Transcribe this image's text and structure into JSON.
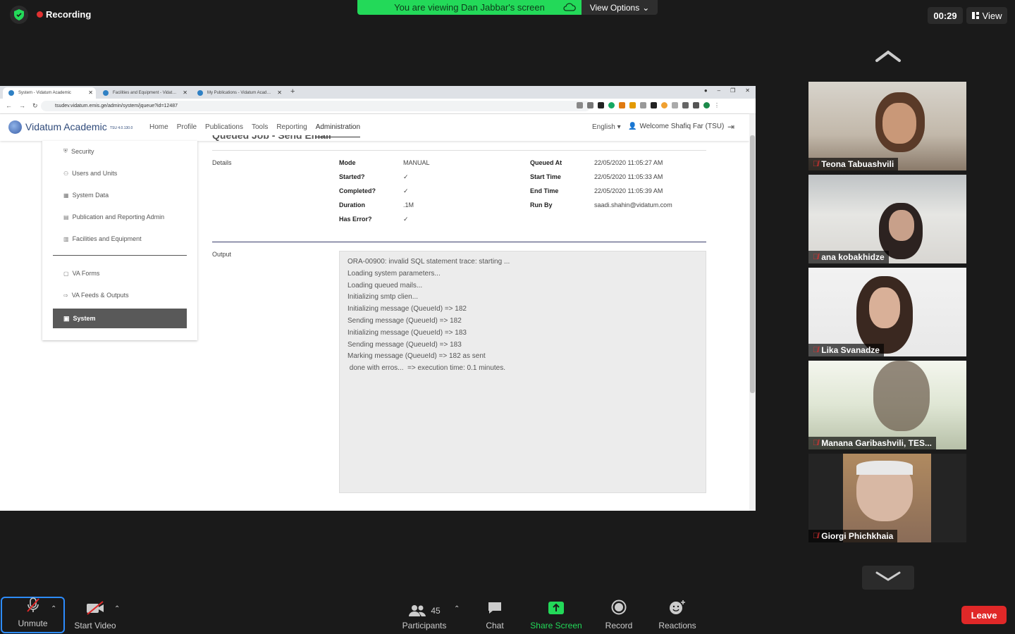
{
  "zoom": {
    "recording_label": "Recording",
    "viewing_banner": "You are viewing Dan Jabbar's screen",
    "view_options": "View Options",
    "timer": "00:29",
    "view_label": "View",
    "colors": {
      "banner": "#23d959",
      "leave": "#e02828",
      "focus": "#2d8cff",
      "share": "#23d959"
    }
  },
  "browser": {
    "tabs": [
      {
        "title": "System - Vidatum Academic",
        "active": true
      },
      {
        "title": "Facilities and Equipment - Vidat…",
        "active": false
      },
      {
        "title": "My Publications - Vidatum Acad…",
        "active": false
      }
    ],
    "url": "tsudev.vidatum.emis.ge/admin/system/jqueue?id=12487"
  },
  "app": {
    "brand": "Vidatum Academic",
    "version": "TSU 4.0.130.0",
    "menu": [
      "Home",
      "Profile",
      "Publications",
      "Tools",
      "Reporting",
      "Administration"
    ],
    "language": "English",
    "welcome": "Welcome Shafiq Far (TSU)"
  },
  "sidebar": {
    "items": [
      "Security",
      "Users and Units",
      "System Data",
      "Publication and Reporting Admin",
      "Facilities and Equipment",
      "VA Forms",
      "VA Feeds & Outputs"
    ],
    "active": "System"
  },
  "page": {
    "title": "Queued Job - Send Email",
    "details_label": "Details",
    "details_left": [
      {
        "label": "Mode",
        "value": "MANUAL"
      },
      {
        "label": "Started?",
        "value": "✓"
      },
      {
        "label": "Completed?",
        "value": "✓"
      },
      {
        "label": "Duration",
        "value": ".1M"
      },
      {
        "label": "Has Error?",
        "value": "✓"
      }
    ],
    "details_right": [
      {
        "label": "Queued At",
        "value": "22/05/2020 11:05:27 AM"
      },
      {
        "label": "Start Time",
        "value": "22/05/2020 11:05:33 AM"
      },
      {
        "label": "End Time",
        "value": "22/05/2020 11:05:39 AM"
      },
      {
        "label": "Run By",
        "value": "saadi.shahin@vidatum.com"
      }
    ],
    "output_label": "Output",
    "output": "ORA-00900: invalid SQL statement trace: starting ...\nLoading system parameters...\nLoading queued mails...\nInitializing smtp clien...\nInitializing message (QueueId) => 182\nSending message (QueueId) => 182\nInitializing message (QueueId) => 183\nSending message (QueueId) => 183\nMarking message (QueueId) => 182 as sent\n done with erros...  => execution time: 0.1 minutes."
  },
  "participants_panel": [
    {
      "name": "Teona Tabuashvili"
    },
    {
      "name": "ana kobakhidze"
    },
    {
      "name": "Lika Svanadze"
    },
    {
      "name": "Manana Garibashvili, TES..."
    },
    {
      "name": "Giorgi Phichkhaia"
    }
  ],
  "toolbar": {
    "unmute": "Unmute",
    "start_video": "Start Video",
    "participants": "Participants",
    "participant_count": "45",
    "chat": "Chat",
    "share_screen": "Share Screen",
    "record": "Record",
    "reactions": "Reactions",
    "leave": "Leave"
  }
}
